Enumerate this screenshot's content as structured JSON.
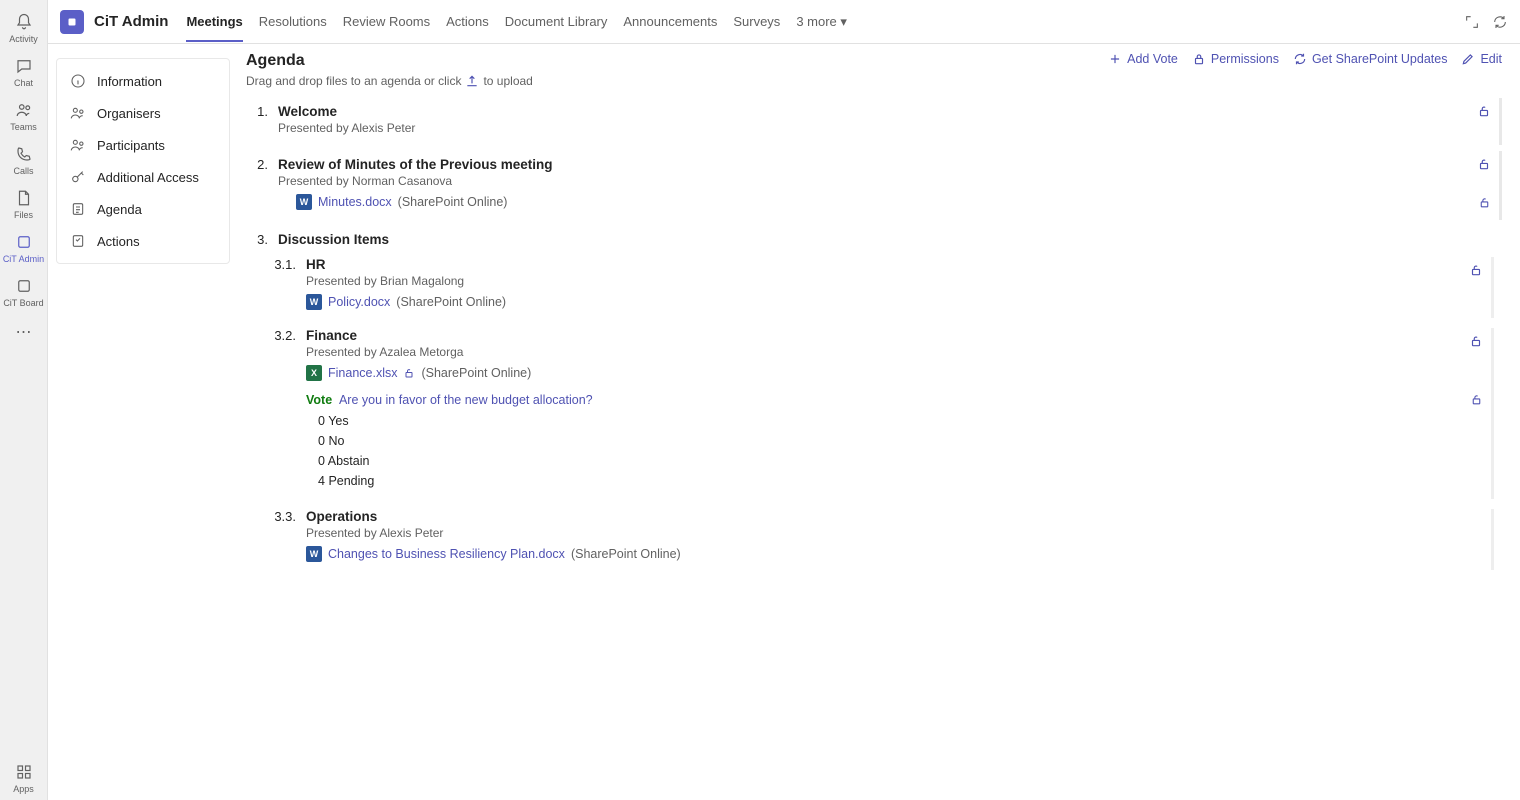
{
  "rail": {
    "items": [
      {
        "label": "Activity"
      },
      {
        "label": "Chat"
      },
      {
        "label": "Teams"
      },
      {
        "label": "Calls"
      },
      {
        "label": "Files"
      },
      {
        "label": "CiT Admin"
      },
      {
        "label": "CiT Board"
      }
    ],
    "apps_label": "Apps"
  },
  "header": {
    "team_name": "CiT Admin",
    "tabs": [
      "Meetings",
      "Resolutions",
      "Review Rooms",
      "Actions",
      "Document Library",
      "Announcements",
      "Surveys"
    ],
    "more_label": "3 more"
  },
  "sidepanel": {
    "items": [
      {
        "label": "Information"
      },
      {
        "label": "Organisers"
      },
      {
        "label": "Participants"
      },
      {
        "label": "Additional Access"
      },
      {
        "label": "Agenda"
      },
      {
        "label": "Actions"
      }
    ]
  },
  "agenda": {
    "title": "Agenda",
    "subtitle_pre": "Drag and drop files to an agenda or click",
    "subtitle_post": "to upload",
    "actions": {
      "add_vote": "Add Vote",
      "permissions": "Permissions",
      "get_updates": "Get SharePoint Updates",
      "edit": "Edit"
    },
    "items": [
      {
        "num": "1.",
        "title": "Welcome",
        "presenter": "Presented by Alexis Peter"
      },
      {
        "num": "2.",
        "title": "Review of Minutes of the Previous meeting",
        "presenter": "Presented by Norman Casanova",
        "file": {
          "name": "Minutes.docx",
          "source": "(SharePoint Online)",
          "type": "word"
        }
      },
      {
        "num": "3.",
        "title": "Discussion Items",
        "subs": [
          {
            "num": "3.1.",
            "title": "HR",
            "presenter": "Presented by Brian Magalong",
            "file": {
              "name": "Policy.docx",
              "source": "(SharePoint Online)",
              "type": "word"
            }
          },
          {
            "num": "3.2.",
            "title": "Finance",
            "presenter": "Presented by Azalea Metorga",
            "file": {
              "name": "Finance.xlsx",
              "source": "(SharePoint Online)",
              "type": "excel"
            },
            "vote": {
              "label": "Vote",
              "question": "Are you in favor of the new budget allocation?",
              "counts": [
                {
                  "n": 0,
                  "label": "Yes"
                },
                {
                  "n": 0,
                  "label": "No"
                },
                {
                  "n": 0,
                  "label": "Abstain"
                },
                {
                  "n": 4,
                  "label": "Pending"
                }
              ]
            }
          },
          {
            "num": "3.3.",
            "title": "Operations",
            "presenter": "Presented by Alexis Peter",
            "file": {
              "name": "Changes to Business Resiliency Plan.docx",
              "source": "(SharePoint Online)",
              "type": "word"
            }
          }
        ]
      }
    ]
  }
}
